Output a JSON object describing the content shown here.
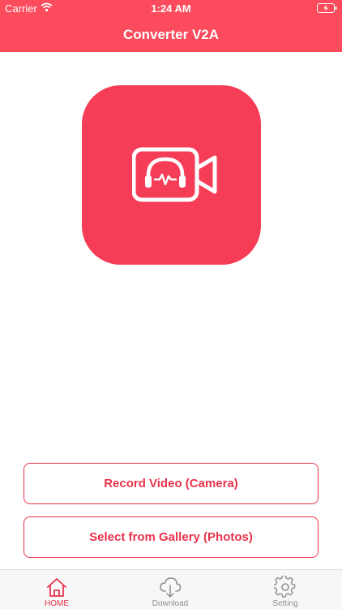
{
  "status_bar": {
    "carrier": "Carrier",
    "time": "1:24 AM"
  },
  "header": {
    "title": "Converter V2A"
  },
  "logo": {
    "icon": "video-audio-camera-icon"
  },
  "buttons": {
    "record_label": "Record Video (Camera)",
    "gallery_label": "Select from Gallery (Photos)"
  },
  "tabs": [
    {
      "label": "HOME",
      "icon": "home-icon",
      "active": true
    },
    {
      "label": "Download",
      "icon": "cloud-download-icon",
      "active": false
    },
    {
      "label": "Setting",
      "icon": "gear-icon",
      "active": false
    }
  ],
  "colors": {
    "accent": "#fb4b5c",
    "logo_bg": "#f53d58",
    "button": "#e8334c",
    "inactive_tab": "#8e8e93"
  }
}
